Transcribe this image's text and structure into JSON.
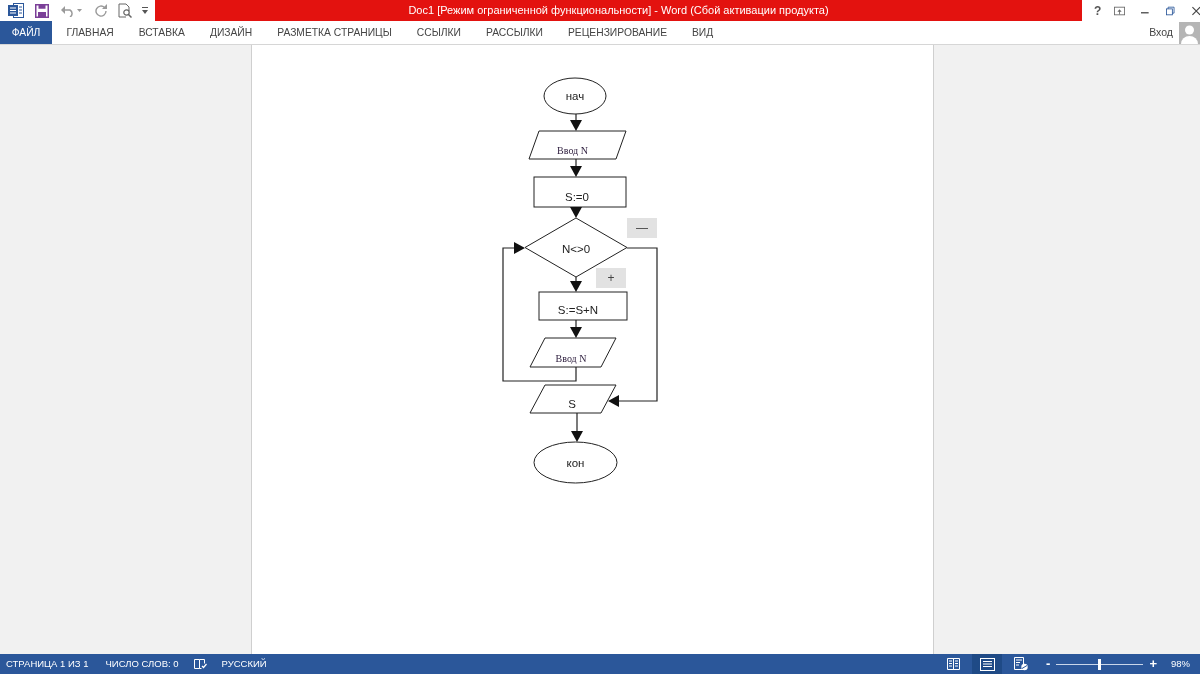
{
  "window": {
    "title": "Doc1 [Режим ограниченной функциональности] - Word (Сбой активации продукта)",
    "help": "?"
  },
  "ribbon": {
    "tabs": [
      {
        "label": "ФАЙЛ",
        "kind": "backstage"
      },
      {
        "label": "ГЛАВНАЯ",
        "kind": "tab"
      },
      {
        "label": "ВСТАВКА",
        "kind": "tab"
      },
      {
        "label": "ДИЗАЙН",
        "kind": "tab"
      },
      {
        "label": "РАЗМЕТКА СТРАНИЦЫ",
        "kind": "tab"
      },
      {
        "label": "ССЫЛКИ",
        "kind": "tab"
      },
      {
        "label": "РАССЫЛКИ",
        "kind": "tab"
      },
      {
        "label": "РЕЦЕНЗИРОВАНИЕ",
        "kind": "tab"
      },
      {
        "label": "ВИД",
        "kind": "tab"
      }
    ],
    "sign_in": "Вход"
  },
  "document": {
    "flowchart": {
      "nodes": [
        {
          "kind": "terminal",
          "text": "нач"
        },
        {
          "kind": "input",
          "text": "Ввод N"
        },
        {
          "kind": "process",
          "text": "S:=0"
        },
        {
          "kind": "decision",
          "text": "N<>0"
        },
        {
          "kind": "process",
          "text": "S:=S+N"
        },
        {
          "kind": "input",
          "text": "Ввод N"
        },
        {
          "kind": "output",
          "text": "S"
        },
        {
          "kind": "terminal",
          "text": "кон"
        }
      ],
      "branch_labels": [
        {
          "text": "—"
        },
        {
          "text": "+"
        }
      ]
    }
  },
  "status_bar": {
    "page": "СТРАНИЦА 1 ИЗ 1",
    "word_count": "ЧИСЛО СЛОВ: 0",
    "language": "РУССКИЙ",
    "views": [
      {
        "kind": "read",
        "selected": false
      },
      {
        "kind": "print",
        "selected": true
      },
      {
        "kind": "web",
        "selected": false
      }
    ],
    "zoom": {
      "zoom_out": "-",
      "level": 0.49,
      "zoom_in": "+",
      "reading": "98%"
    }
  }
}
